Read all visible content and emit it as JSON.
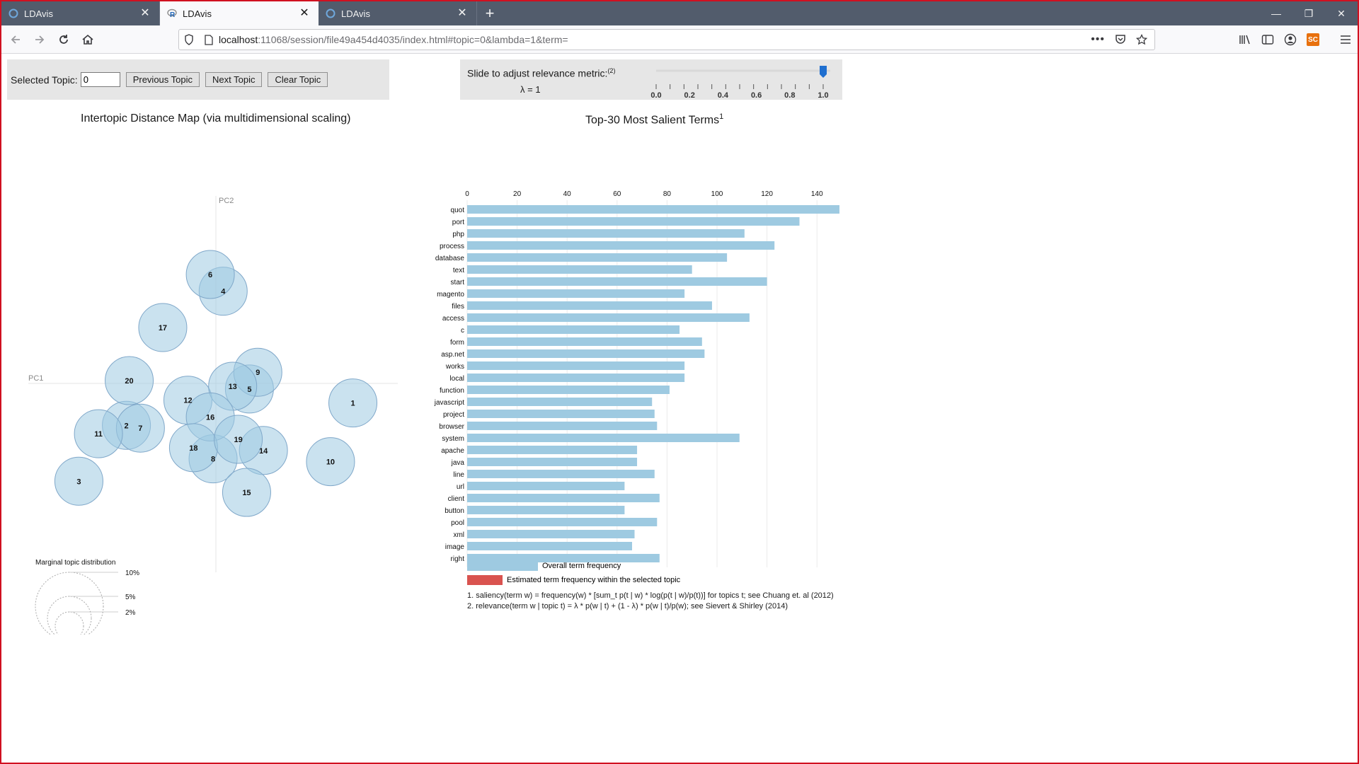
{
  "browser": {
    "tabs": [
      {
        "title": "LDAvis",
        "active": false
      },
      {
        "title": "LDAvis",
        "active": true
      },
      {
        "title": "LDAvis",
        "active": false
      }
    ],
    "url_host": "localhost",
    "url_rest": ":11068/session/file49a454d4035/index.html#topic=0&lambda=1&term=",
    "window_controls": [
      "minimize-icon",
      "restore-icon",
      "close-icon"
    ]
  },
  "controls": {
    "selected_topic_label": "Selected Topic:",
    "selected_topic_value": "0",
    "prev_button": "Previous Topic",
    "next_button": "Next Topic",
    "clear_button": "Clear Topic",
    "relevance_label": "Slide to adjust relevance metric:",
    "relevance_sup": "(2)",
    "lambda_text": "λ = 1",
    "slider_value": 1.0,
    "slider_ticks": [
      "0.0",
      "0.2",
      "0.4",
      "0.6",
      "0.8",
      "1.0"
    ]
  },
  "left_title": "Intertopic Distance Map (via multidimensional scaling)",
  "right_title": "Top-30 Most Salient Terms",
  "right_title_sup": "1",
  "legend": {
    "overall": "Overall term frequency",
    "estimated": "Estimated term frequency within the selected topic",
    "overall_color": "#9ecae1",
    "estimated_color": "#d9534f"
  },
  "footnotes": [
    "1. saliency(term w) = frequency(w) * [sum_t p(t | w) * log(p(t | w)/p(t))] for topics t; see Chuang et. al (2012)",
    "2. relevance(term w | topic t) = λ * p(w | t) + (1 - λ) * p(w | t)/p(w); see Sievert & Shirley (2014)"
  ],
  "chart_data": [
    {
      "type": "scatter",
      "title": "Intertopic Distance Map (via multidimensional scaling)",
      "xlabel": "PC1",
      "ylabel": "PC2",
      "bubble_color": "#9ecae1",
      "points": [
        {
          "topic": "1",
          "x": 0.245,
          "y": -0.035
        },
        {
          "topic": "2",
          "x": -0.16,
          "y": -0.075
        },
        {
          "topic": "3",
          "x": -0.245,
          "y": -0.175
        },
        {
          "topic": "4",
          "x": 0.013,
          "y": 0.165
        },
        {
          "topic": "5",
          "x": 0.06,
          "y": -0.01
        },
        {
          "topic": "6",
          "x": -0.01,
          "y": 0.195
        },
        {
          "topic": "7",
          "x": -0.135,
          "y": -0.08
        },
        {
          "topic": "8",
          "x": -0.005,
          "y": -0.135
        },
        {
          "topic": "9",
          "x": 0.075,
          "y": 0.02
        },
        {
          "topic": "10",
          "x": 0.205,
          "y": -0.14
        },
        {
          "topic": "11",
          "x": -0.21,
          "y": -0.09
        },
        {
          "topic": "12",
          "x": -0.05,
          "y": -0.03
        },
        {
          "topic": "13",
          "x": 0.03,
          "y": -0.005
        },
        {
          "topic": "14",
          "x": 0.085,
          "y": -0.12
        },
        {
          "topic": "15",
          "x": 0.055,
          "y": -0.195
        },
        {
          "topic": "16",
          "x": -0.01,
          "y": -0.06
        },
        {
          "topic": "17",
          "x": -0.095,
          "y": 0.1
        },
        {
          "topic": "18",
          "x": -0.04,
          "y": -0.115
        },
        {
          "topic": "19",
          "x": 0.04,
          "y": -0.1
        },
        {
          "topic": "20",
          "x": -0.155,
          "y": 0.005
        }
      ],
      "marginal_topic_distribution": {
        "title": "Marginal topic distribution",
        "labels": [
          "2%",
          "5%",
          "10%"
        ]
      }
    },
    {
      "type": "bar",
      "title": "Top-30 Most Salient Terms",
      "xlim": [
        0,
        150
      ],
      "xticks": [
        0,
        20,
        40,
        60,
        80,
        100,
        120,
        140
      ],
      "categories": [
        "quot",
        "port",
        "php",
        "process",
        "database",
        "text",
        "start",
        "magento",
        "files",
        "access",
        "c",
        "form",
        "asp.net",
        "works",
        "local",
        "function",
        "javascript",
        "project",
        "browser",
        "system",
        "apache",
        "java",
        "line",
        "url",
        "client",
        "button",
        "pool",
        "xml",
        "image",
        "right"
      ],
      "series": [
        {
          "name": "Overall term frequency",
          "values": [
            149,
            133,
            111,
            123,
            104,
            90,
            120,
            87,
            98,
            113,
            85,
            94,
            95,
            87,
            87,
            81,
            74,
            75,
            76,
            109,
            68,
            68,
            75,
            63,
            77,
            63,
            76,
            67,
            66,
            77
          ]
        }
      ]
    }
  ]
}
